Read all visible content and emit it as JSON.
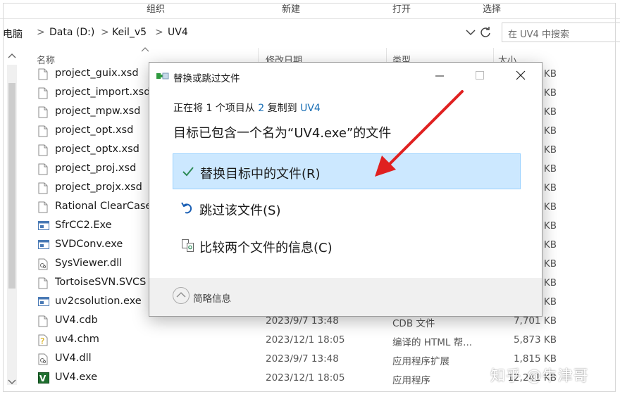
{
  "ribbon": {
    "organize": "组织",
    "new": "新建",
    "open": "打开",
    "select": "选择"
  },
  "address": {
    "crumbs": [
      "电脑",
      "Data (D:)",
      "Keil_v5",
      "UV4"
    ],
    "separator": ">"
  },
  "search": {
    "placeholder": "在 UV4 中搜索"
  },
  "columns": {
    "name": "名称",
    "modified": "修改日期",
    "type": "类型",
    "size": "大小"
  },
  "files": [
    {
      "name": "project_guix.xsd",
      "date": "",
      "type": "",
      "size": "KB",
      "icon": "file-icon"
    },
    {
      "name": "project_import.xsd",
      "date": "",
      "type": "",
      "size": "KB",
      "icon": "file-icon"
    },
    {
      "name": "project_mpw.xsd",
      "date": "",
      "type": "",
      "size": "KB",
      "icon": "file-icon"
    },
    {
      "name": "project_opt.xsd",
      "date": "",
      "type": "",
      "size": "KB",
      "icon": "file-icon"
    },
    {
      "name": "project_optx.xsd",
      "date": "",
      "type": "",
      "size": "KB",
      "icon": "file-icon"
    },
    {
      "name": "project_proj.xsd",
      "date": "",
      "type": "",
      "size": "KB",
      "icon": "file-icon"
    },
    {
      "name": "project_projx.xsd",
      "date": "",
      "type": "",
      "size": "KB",
      "icon": "file-icon"
    },
    {
      "name": "Rational ClearCase",
      "date": "",
      "type": "",
      "size": "KB",
      "icon": "file-icon"
    },
    {
      "name": "SfrCC2.Exe",
      "date": "",
      "type": "",
      "size": "KB",
      "icon": "exe-icon"
    },
    {
      "name": "SVDConv.exe",
      "date": "",
      "type": "",
      "size": "KB",
      "icon": "exe-icon"
    },
    {
      "name": "SysViewer.dll",
      "date": "",
      "type": "",
      "size": "KB",
      "icon": "dll-icon"
    },
    {
      "name": "TortoiseSVN.SVCS",
      "date": "",
      "type": "",
      "size": "KB",
      "icon": "file-icon"
    },
    {
      "name": "uv2csolution.exe",
      "date": "",
      "type": "",
      "size": "KB",
      "icon": "exe-icon"
    },
    {
      "name": "UV4.cdb",
      "date": "2023/9/7 13:48",
      "type": "CDB 文件",
      "size": "7,701 KB",
      "icon": "file-icon"
    },
    {
      "name": "uv4.chm",
      "date": "2023/12/1 18:05",
      "type": "编译的 HTML 帮...",
      "size": "5,873 KB",
      "icon": "chm-icon"
    },
    {
      "name": "UV4.dll",
      "date": "2023/9/7 13:48",
      "type": "应用程序扩展",
      "size": "1,815 KB",
      "icon": "dll-icon"
    },
    {
      "name": "UV4.exe",
      "date": "2023/12/1 18:05",
      "type": "应用程序",
      "size": "12,241 KB",
      "icon": "uv4-app-icon"
    }
  ],
  "dialog": {
    "title": "替换或跳过文件",
    "line1": {
      "prefix": "正在将 1 个项目从 ",
      "src": "2",
      "mid": " 复制到 ",
      "dst": "UV4"
    },
    "heading": "目标已包含一个名为“UV4.exe”的文件",
    "options": {
      "replace": "替换目标中的文件(R)",
      "skip": "跳过该文件(S)",
      "compare": "比较两个文件的信息(C)"
    },
    "footer": "简略信息"
  },
  "watermark": "知乎 @牛津哥",
  "colors": {
    "selection": "#cce8ff",
    "link": "#1a6fb5",
    "arrow": "#e02020",
    "check": "#2e8b57"
  }
}
